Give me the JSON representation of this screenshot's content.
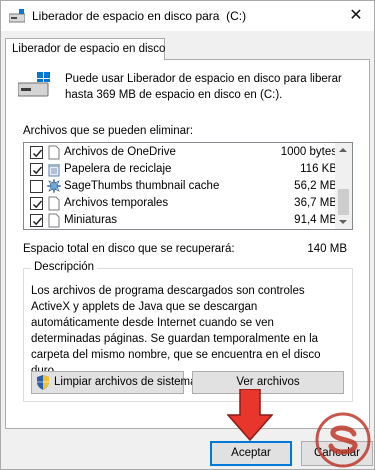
{
  "window": {
    "title": "Liberador de espacio en disco para  (C:)",
    "close_glyph": "✕"
  },
  "tab": {
    "label": "Liberador de espacio en disco"
  },
  "intro": {
    "text": "Puede usar Liberador de espacio en disco para liberar hasta 369 MB de espacio en disco en  (C:).",
    "icon": "drive-icon"
  },
  "files": {
    "label": "Archivos que se pueden eliminar:",
    "items": [
      {
        "name": "Archivos de OneDrive",
        "size": "1000 bytes",
        "checked": true,
        "icon": "file-icon"
      },
      {
        "name": "Papelera de reciclaje",
        "size": "116 KB",
        "checked": true,
        "icon": "recycle-bin-icon"
      },
      {
        "name": "SageThumbs thumbnail cache",
        "size": "56,2 MB",
        "checked": false,
        "icon": "sagethumbs-icon"
      },
      {
        "name": "Archivos temporales",
        "size": "36,7 MB",
        "checked": true,
        "icon": "file-icon"
      },
      {
        "name": "Miniaturas",
        "size": "91,4 MB",
        "checked": true,
        "icon": "file-icon"
      }
    ]
  },
  "total": {
    "label": "Espacio total en disco que se recuperará:",
    "value": "140 MB"
  },
  "description": {
    "title": "Descripción",
    "text": "Los archivos de programa descargados son controles ActiveX y applets de Java que se descargan automáticamente desde Internet cuando se ven determinadas páginas. Se guardan temporalmente en la carpeta del mismo nombre, que se encuentra en el disco duro."
  },
  "buttons": {
    "clean_system": "Limpiar archivos de sistema",
    "view_files": "Ver archivos",
    "ok": "Aceptar",
    "cancel": "Cancelar"
  },
  "colors": {
    "accent": "#0078d7",
    "arrow": "#e8362c",
    "watermark": "#c0392b"
  }
}
